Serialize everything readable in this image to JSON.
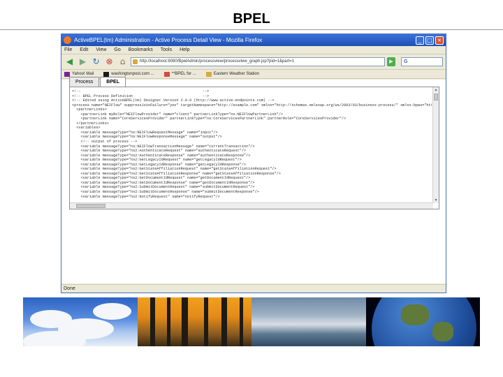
{
  "slide": {
    "title": "BPEL"
  },
  "window": {
    "title": "ActiveBPEL(tm) Administration - Active Process Detail View - Mozilla Firefox",
    "menu": [
      "File",
      "Edit",
      "View",
      "Go",
      "Bookmarks",
      "Tools",
      "Help"
    ],
    "url": "http://localhost:8080/BpelAdmin/processview/processview_graph.jsp?pid=1&part=1",
    "search_label": "G",
    "bookmarks": [
      "Yahoo! Mail",
      "washingtonpost.com ...",
      "**BPEL for ...",
      "Eastern Weather Station"
    ],
    "status": "Done"
  },
  "tabs": [
    {
      "label": "Process",
      "active": false
    },
    {
      "label": "BPEL",
      "active": true
    }
  ],
  "code_lines": [
    "<!--                                                        -->",
    "<!-- BPEL Process Definition                                -->",
    "<!-- Edited using ActiveBPEL(tm) Designer Version 2.0.0 (http://www.active-endpoints.com) -->",
    "<process name=\"NEIFlow\" suppressJoinFailure=\"yes\" targetNamespace=\"http://example.com\" xmlns=\"http://schemas.xmlsoap.org/ws/2003/03/business-process/\" xmlns:bpws=\"http://sc",
    "  <partnerLinks>",
    "    <partnerLink myRole=\"NEIFlowProvider\" name=\"client\" partnerLinkType=\"ns:NEIFlowPartnerLink\"/>",
    "    <partnerLink name=\"CoreServicesProvider\" partnerLinkType=\"ns:CoreServicesPartnerLink\" partnerRole=\"CoreServicesProvider\"/>",
    "  </partnerLinks>",
    "  <variables>",
    "    <variable messageType=\"ns:NEIFlowRequestMessage\" name=\"input\"/>",
    "    <variable messageType=\"ns:NEIFlowResponseMessage\" name=\"output\"/>",
    "    <!-- output of process -->",
    "    <variable messageType=\"ns:NEIFlowTransactionMessage\" name=\"currentTransaction\"/>",
    "    <variable messageType=\"ns2:AuthenticateRequest\" name=\"authenticateRequest\"/>",
    "    <variable messageType=\"ns2:AuthenticateResponse\" name=\"authenticateResponse\"/>",
    "    <variable messageType=\"ns2:GetLegacyIdRequest\" name=\"getLegacyIdRequest\"/>",
    "    <variable messageType=\"ns2:GetLegacyIdResponse\" name=\"getLegacyIdResponse\"/>",
    "    <variable messageType=\"ns2:GetStateAffiliationRequest\" name=\"getStateAffiliationRequest\"/>",
    "    <variable messageType=\"ns2:GetStateAffiliationResponse\" name=\"getStateAffiliationResponse\"/>",
    "    <variable messageType=\"ns2:GetDocumentIdRequest\" name=\"getDocumentIdRequest\"/>",
    "    <variable messageType=\"ns2:GetDocumentIdResponse\" name=\"getDocumentIdResponse\"/>",
    "    <variable messageType=\"ns2:SubmitDocumentRequest\" name=\"submitDocumentRequest\"/>",
    "    <variable messageType=\"ns2:SubmitDocumentResponse\" name=\"submitDocumentResponse\"/>",
    "    <variable messageType=\"ns2:NotifyRequest\" name=\"notifyRequest\"/>"
  ],
  "colors": {
    "title_bar": "#2a5fc7",
    "chrome": "#ece9d8",
    "slide_rule": "#9a9a9a"
  },
  "icons": [
    "back-arrow-icon",
    "forward-arrow-icon",
    "reload-icon",
    "stop-icon",
    "home-icon",
    "go-icon"
  ]
}
